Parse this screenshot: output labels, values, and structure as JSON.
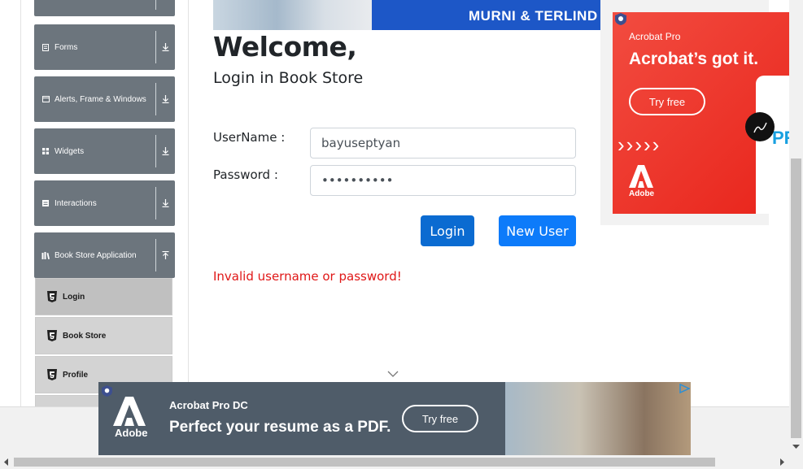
{
  "sidebar": {
    "groups": [
      {
        "label": "Forms"
      },
      {
        "label": "Alerts, Frame & Windows"
      },
      {
        "label": "Widgets"
      },
      {
        "label": "Interactions"
      },
      {
        "label": "Book Store Application"
      }
    ],
    "items": [
      {
        "label": "Login"
      },
      {
        "label": "Book Store"
      },
      {
        "label": "Profile"
      }
    ]
  },
  "banner": {
    "text": "MURNI & TERLIND"
  },
  "main": {
    "title": "Welcome,",
    "subtitle": "Login in Book Store",
    "username_label": "UserName :",
    "username_value": "bayuseptyan",
    "password_label": "Password :",
    "password_value": "••••••••••",
    "login_button": "Login",
    "new_user_button": "New User",
    "error": "Invalid username or password!"
  },
  "ad_right": {
    "eyebrow": "Acrobat Pro",
    "headline": "Acrobat’s got it.",
    "cta": "Try free",
    "brand": "Adobe",
    "screen_text": "PRO"
  },
  "ad_bottom": {
    "product": "Acrobat Pro DC",
    "headline": "Perfect your resume as a PDF.",
    "cta": "Try free",
    "brand": "Adobe"
  },
  "colors": {
    "primary": "#0d7bfa",
    "sidebar_group": "#6c757d",
    "error": "#e01717",
    "ad_red": "#eb3a2d"
  }
}
